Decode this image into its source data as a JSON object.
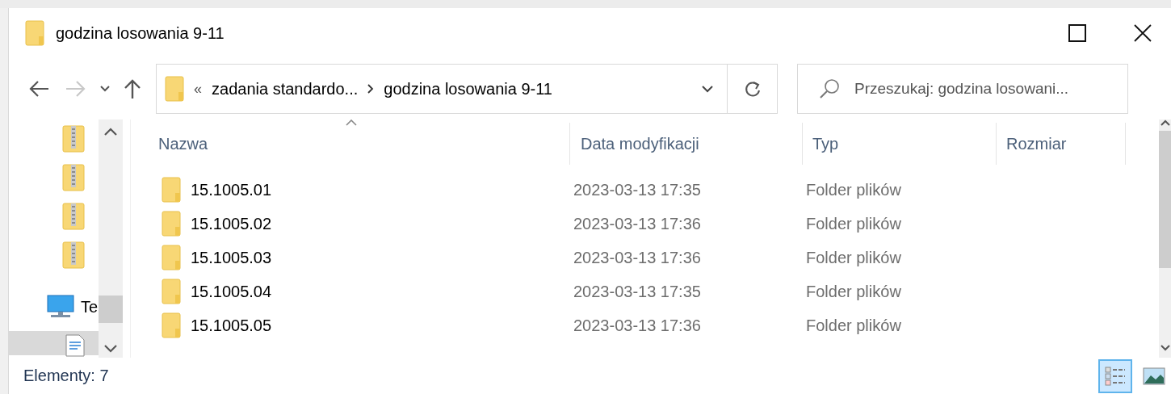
{
  "window": {
    "title": "godzina losowania 9-11"
  },
  "nav_buttons": [
    {
      "kind": "back",
      "disabled": false
    },
    {
      "kind": "forward",
      "disabled": true
    },
    {
      "kind": "recent",
      "disabled": false
    },
    {
      "kind": "up",
      "disabled": false
    }
  ],
  "address": {
    "overflow": "«",
    "crumbs": [
      "zadania standardo...",
      "godzina losowania 9-11"
    ]
  },
  "search": {
    "placeholder": "Przeszukaj: godzina losowani..."
  },
  "sidebar": {
    "items": [
      {
        "kind": "zip",
        "selected": false
      },
      {
        "kind": "zip",
        "selected": false
      },
      {
        "kind": "zip",
        "selected": false
      },
      {
        "kind": "zip",
        "selected": false
      },
      {
        "kind": "computer",
        "label": "Te",
        "selected": false
      },
      {
        "kind": "document",
        "selected": true
      }
    ]
  },
  "table": {
    "columns": [
      {
        "label": "Nazwa",
        "sorted": true
      },
      {
        "label": "Data modyfikacji",
        "sorted": false
      },
      {
        "label": "Typ",
        "sorted": false
      },
      {
        "label": "Rozmiar",
        "sorted": false
      }
    ],
    "rows": [
      {
        "name": "15.1005.01",
        "date": "2023-03-13 17:35",
        "type": "Folder plików"
      },
      {
        "name": "15.1005.02",
        "date": "2023-03-13 17:36",
        "type": "Folder plików"
      },
      {
        "name": "15.1005.03",
        "date": "2023-03-13 17:36",
        "type": "Folder plików"
      },
      {
        "name": "15.1005.04",
        "date": "2023-03-13 17:35",
        "type": "Folder plików"
      },
      {
        "name": "15.1005.05",
        "date": "2023-03-13 17:36",
        "type": "Folder plików"
      }
    ]
  },
  "status_bar": {
    "count": "Elementy: 7",
    "views": [
      {
        "kind": "details",
        "selected": true
      },
      {
        "kind": "tiles",
        "selected": false
      }
    ]
  }
}
